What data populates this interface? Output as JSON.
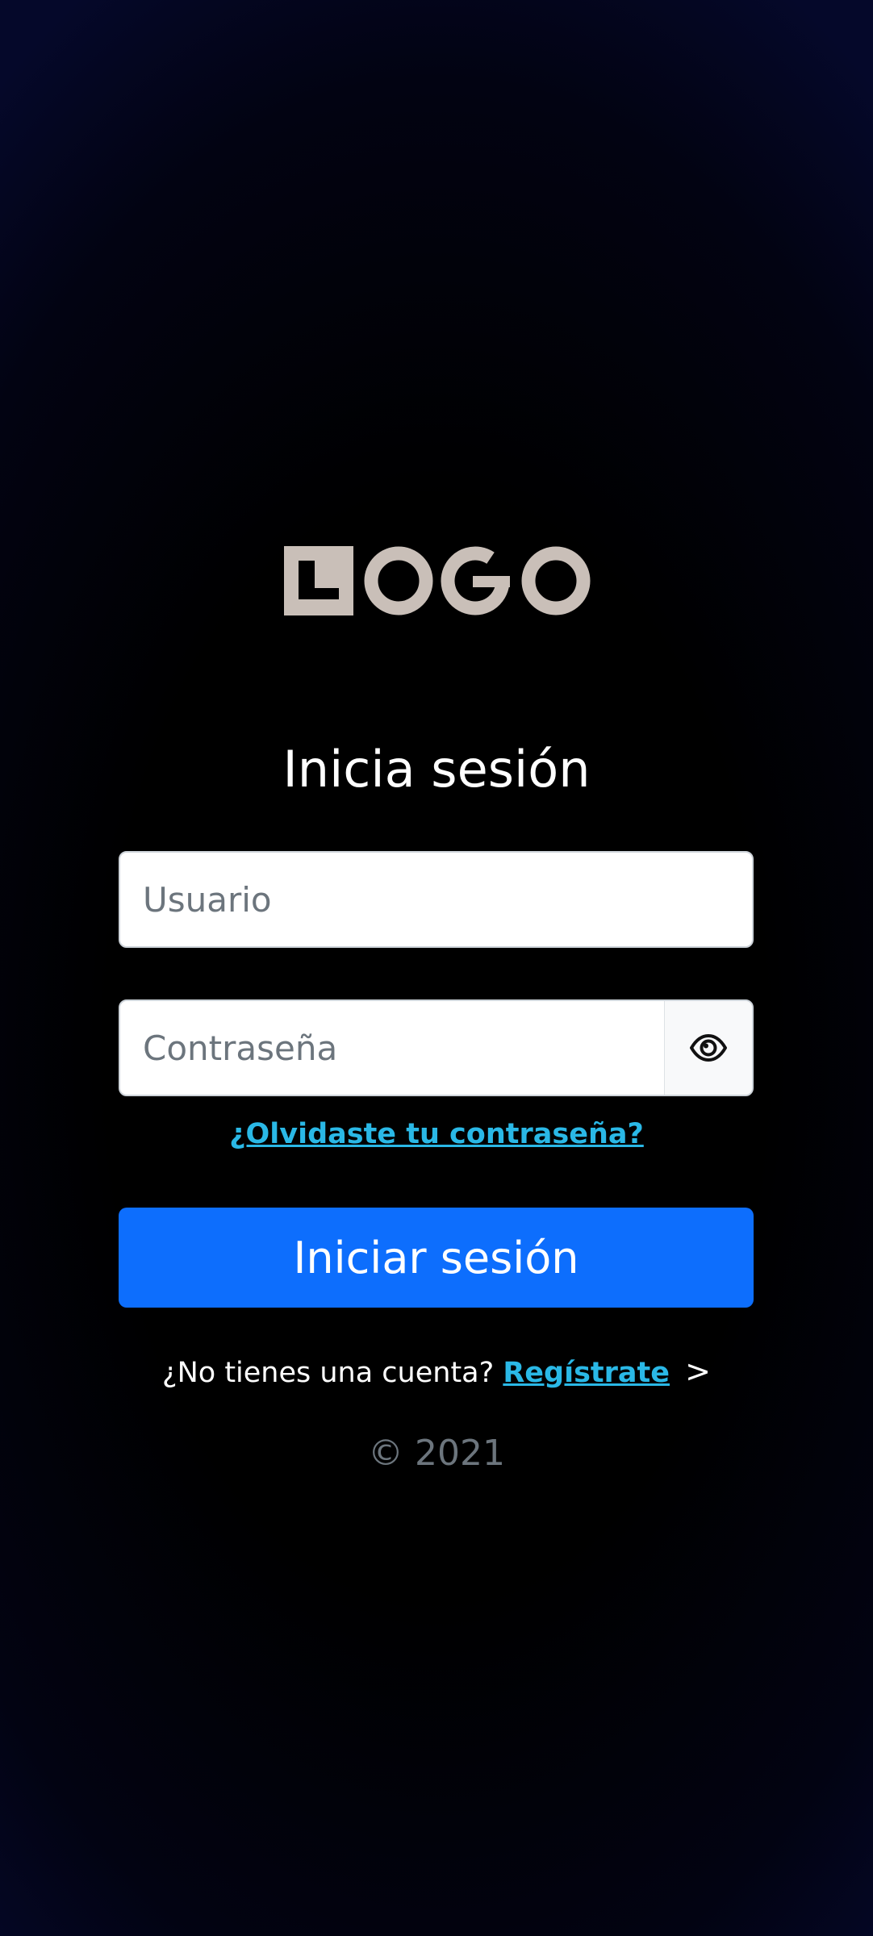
{
  "brand": {
    "logo_text": "LOGO",
    "logo_color": "#c9bfb8"
  },
  "login": {
    "title": "Inicia sesión",
    "username_placeholder": "Usuario",
    "password_placeholder": "Contraseña",
    "forgot_label": "¿Olvidaste tu contraseña?",
    "submit_label": "Iniciar sesión"
  },
  "signup": {
    "prompt": "¿No tienes una cuenta?",
    "link_label": "Regístrate",
    "chevron": ">"
  },
  "footer": {
    "copyright": "© 2021"
  },
  "icons": {
    "password_toggle": "eye-icon"
  },
  "colors": {
    "primary": "#0d6efd",
    "link": "#2ab8e6",
    "muted": "#6c757d"
  }
}
